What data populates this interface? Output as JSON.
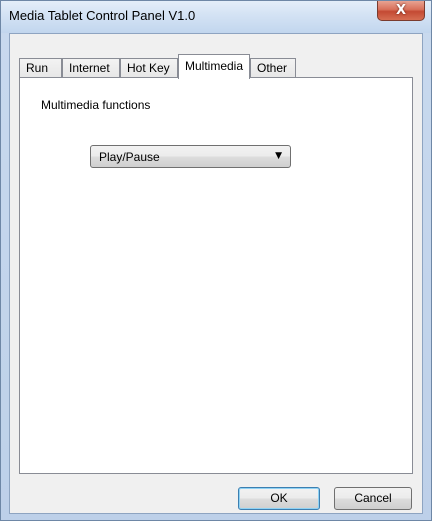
{
  "window": {
    "title": "Media Tablet Control Panel V1.0",
    "close_symbol": "X"
  },
  "tabs": [
    {
      "label": "Run",
      "active": false
    },
    {
      "label": "Internet",
      "active": false
    },
    {
      "label": "Hot Key",
      "active": false
    },
    {
      "label": "Multimedia",
      "active": true
    },
    {
      "label": "Other",
      "active": false
    }
  ],
  "multimedia": {
    "group_label": "Multimedia functions",
    "function_select": {
      "value": "Play/Pause",
      "arrow_icon": "dropdown-arrow-icon",
      "arrow_glyph": "▼"
    }
  },
  "buttons": {
    "ok": "OK",
    "cancel": "Cancel"
  },
  "colors": {
    "titlebar": "#c8d9ee",
    "close": "#c34a33",
    "panel": "#ffffff",
    "client": "#f0f0f0"
  }
}
